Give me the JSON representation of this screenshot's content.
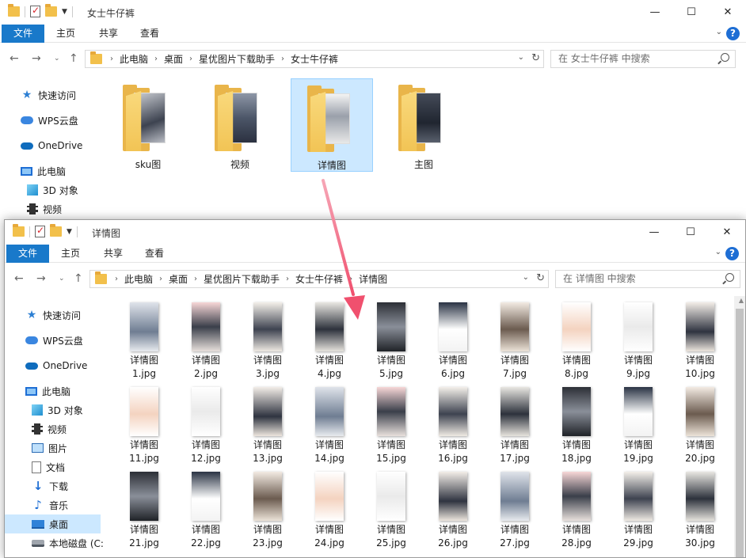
{
  "back_window": {
    "title": "女士牛仔裤",
    "tabs": [
      "文件",
      "主页",
      "共享",
      "查看"
    ],
    "breadcrumb": [
      "此电脑",
      "桌面",
      "星优图片下载助手",
      "女士牛仔裤"
    ],
    "search_placeholder": "在 女士牛仔裤 中搜索",
    "sidebar": [
      "快速访问",
      "WPS云盘",
      "OneDrive",
      "此电脑",
      "3D 对象",
      "视频"
    ],
    "folders": [
      {
        "label": "sku图",
        "selected": false
      },
      {
        "label": "视频",
        "selected": false
      },
      {
        "label": "详情图",
        "selected": true
      },
      {
        "label": "主图",
        "selected": false
      }
    ]
  },
  "front_window": {
    "title": "详情图",
    "tabs": [
      "文件",
      "主页",
      "共享",
      "查看"
    ],
    "breadcrumb": [
      "此电脑",
      "桌面",
      "星优图片下载助手",
      "女士牛仔裤",
      "详情图"
    ],
    "search_placeholder": "在 详情图 中搜索",
    "sidebar": [
      "快速访问",
      "WPS云盘",
      "OneDrive",
      "此电脑",
      "3D 对象",
      "视频",
      "图片",
      "文档",
      "下载",
      "音乐",
      "桌面",
      "本地磁盘 (C:"
    ],
    "selected_sidebar": "桌面",
    "files": [
      {
        "name": "详情图",
        "ext": "1.jpg"
      },
      {
        "name": "详情图",
        "ext": "2.jpg"
      },
      {
        "name": "详情图",
        "ext": "3.jpg"
      },
      {
        "name": "详情图",
        "ext": "4.jpg"
      },
      {
        "name": "详情图",
        "ext": "5.jpg"
      },
      {
        "name": "详情图",
        "ext": "6.jpg"
      },
      {
        "name": "详情图",
        "ext": "7.jpg"
      },
      {
        "name": "详情图",
        "ext": "8.jpg"
      },
      {
        "name": "详情图",
        "ext": "9.jpg"
      },
      {
        "name": "详情图",
        "ext": "10.jpg"
      },
      {
        "name": "详情图",
        "ext": "11.jpg"
      },
      {
        "name": "详情图",
        "ext": "12.jpg"
      },
      {
        "name": "详情图",
        "ext": "13.jpg"
      },
      {
        "name": "详情图",
        "ext": "14.jpg"
      },
      {
        "name": "详情图",
        "ext": "15.jpg"
      },
      {
        "name": "详情图",
        "ext": "16.jpg"
      },
      {
        "name": "详情图",
        "ext": "17.jpg"
      },
      {
        "name": "详情图",
        "ext": "18.jpg"
      },
      {
        "name": "详情图",
        "ext": "19.jpg"
      },
      {
        "name": "详情图",
        "ext": "20.jpg"
      },
      {
        "name": "详情图",
        "ext": "21.jpg"
      },
      {
        "name": "详情图",
        "ext": "22.jpg"
      },
      {
        "name": "详情图",
        "ext": "23.jpg"
      },
      {
        "name": "详情图",
        "ext": "24.jpg"
      },
      {
        "name": "详情图",
        "ext": "25.jpg"
      },
      {
        "name": "详情图",
        "ext": "26.jpg"
      },
      {
        "name": "详情图",
        "ext": "27.jpg"
      },
      {
        "name": "详情图",
        "ext": "28.jpg"
      },
      {
        "name": "详情图",
        "ext": "29.jpg"
      },
      {
        "name": "详情图",
        "ext": "30.jpg"
      }
    ]
  },
  "colors": {
    "file_tab": "#1979ca",
    "selection": "#cce8ff",
    "arrow": "#f0506e"
  }
}
